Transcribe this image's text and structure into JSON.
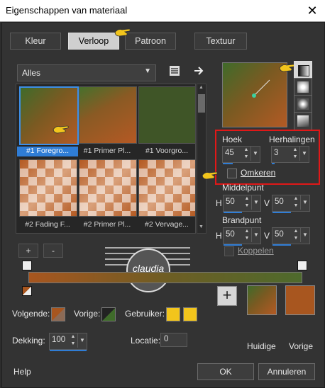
{
  "window": {
    "title": "Eigenschappen van materiaal",
    "close_glyph": "✕"
  },
  "tabs": [
    {
      "label": "Kleur",
      "active": false
    },
    {
      "label": "Verloop",
      "active": true
    },
    {
      "label": "Patroon",
      "active": false
    },
    {
      "label": "Textuur",
      "active": false
    }
  ],
  "gallery": {
    "category": "Alles",
    "items": [
      {
        "label": "#1 Foregro...",
        "selected": true,
        "style": "orange-green"
      },
      {
        "label": "#1 Primer Pl...",
        "selected": false,
        "style": "orange-green2"
      },
      {
        "label": "#1 Voorgro...",
        "selected": false,
        "style": "green"
      },
      {
        "label": "#2 Fading F...",
        "selected": false,
        "style": "check"
      },
      {
        "label": "#2 Primer Pl...",
        "selected": false,
        "style": "check"
      },
      {
        "label": "#2 Vervage...",
        "selected": false,
        "style": "check"
      }
    ],
    "add_label": "+",
    "remove_label": "-"
  },
  "settings": {
    "angle_label": "Hoek",
    "angle_value": "45",
    "repeats_label": "Herhalingen",
    "repeats_value": "3",
    "invert_label": "Omkeren",
    "midpoint_label": "Middelpunt",
    "midpoint_h_label": "H",
    "midpoint_h": "50",
    "midpoint_v_label": "V",
    "midpoint_v": "50",
    "focal_label": "Brandpunt",
    "focal_h_label": "H",
    "focal_h": "50",
    "focal_v_label": "V",
    "focal_v": "50",
    "link_label": "Koppelen"
  },
  "watermark": {
    "text": "claudia"
  },
  "bottom": {
    "next_label": "Volgende:",
    "prev_label": "Vorige:",
    "user_label": "Gebruiker:",
    "opacity_label": "Dekking:",
    "opacity_value": "100",
    "location_label": "Locatie:",
    "location_value": "0",
    "current_label": "Huidige",
    "previous_label": "Vorige",
    "user_color": "#f2c51c",
    "previous_color": "#a8561f"
  },
  "buttons": {
    "help": "Help",
    "ok": "OK",
    "cancel": "Annuleren"
  }
}
